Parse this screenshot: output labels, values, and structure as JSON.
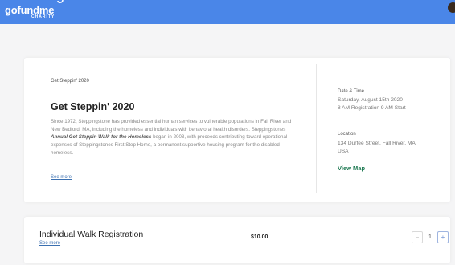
{
  "header": {
    "logo_text": "gofundme",
    "logo_sub": "CHARITY",
    "brand_color": "#4a86e8"
  },
  "event": {
    "breadcrumb": "Get Steppin' 2020",
    "title": "Get Steppin' 2020",
    "description_part1": "Since 1972, Steppingstone has provided essential human services to vulnerable populations in Fall River and New Bedford, MA, including the homeless and individuals with behavioral health disorders. Steppingstones ",
    "description_emphasis": "Annual Get Steppin Walk for the Homeless",
    "description_part2": " began in 2003, with proceeds contributing toward operational expenses of Steppingstones First Step Home, a permanent supportive housing program for the disabled homeless.",
    "see_more": "See more"
  },
  "details": {
    "date_label": "Date & Time",
    "date_value": "Saturday, August 15th 2020",
    "time_value": "8 AM Registration 9 AM Start",
    "location_label": "Location",
    "location_line1": "134 Durfee Street, Fall River, MA,",
    "location_line2": "USA",
    "view_map": "View Map",
    "link_color": "#1f7a53"
  },
  "registration": {
    "title": "Individual Walk Registration",
    "see_more": "See more",
    "price": "$10.00",
    "quantity": "1",
    "minus_label": "−",
    "plus_label": "+"
  }
}
